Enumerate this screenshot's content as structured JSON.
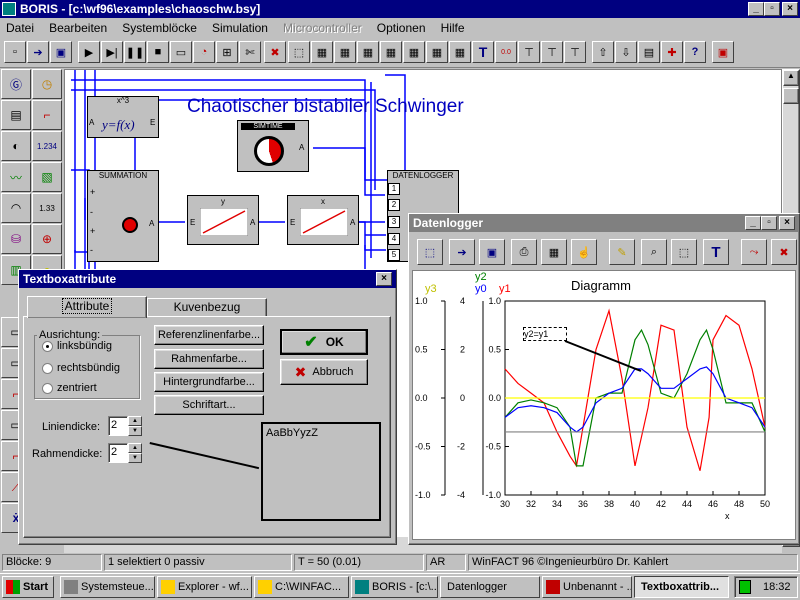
{
  "app": {
    "title": "BORIS - [c:\\wf96\\examples\\chaoschw.bsy]",
    "menus": [
      "Datei",
      "Bearbeiten",
      "Systemblöcke",
      "Simulation",
      "Microcontroller",
      "Optionen",
      "Hilfe"
    ],
    "menus_disabled": [
      "Microcontroller"
    ]
  },
  "diagram": {
    "heading": "Chaotischer bistabiler Schwinger",
    "blocks": {
      "power": {
        "title": "x^3",
        "formula": "y=f(x)",
        "in": "A",
        "out": "E"
      },
      "simtime": {
        "title": "SIMTIME",
        "out": "A"
      },
      "summation": {
        "title": "SUMMATION",
        "out": "A",
        "signs": [
          "+",
          "-",
          "+",
          "-",
          "+"
        ]
      },
      "integrator_y": {
        "title": "y",
        "in": "E",
        "out": "A"
      },
      "integrator_x": {
        "title": "x",
        "in": "E",
        "out": "A"
      },
      "datalogger": {
        "title": "DATENLOGGER",
        "ports": [
          "1",
          "2",
          "3",
          "4",
          "5"
        ]
      }
    }
  },
  "datalogger_window": {
    "title": "Datenlogger",
    "legend": {
      "y3": "y3",
      "y0": "y0",
      "y2": "y2",
      "y1": "y1"
    },
    "colors": {
      "y0": "#0000ff",
      "y1": "#ff0000",
      "y2": "#008000",
      "y3": "#ffff00"
    },
    "annotation": "y2=y1",
    "chart_data": {
      "type": "line",
      "title": "Diagramm",
      "xlabel": "x",
      "ylabel": "",
      "xlim": [
        30,
        50
      ],
      "xticks": [
        "30",
        "32",
        "34",
        "36",
        "38",
        "40",
        "42",
        "44",
        "46",
        "48",
        "50"
      ],
      "y_left_ticks": [
        "1.0",
        "0.5",
        "0.0",
        "-0.5",
        "-1.0"
      ],
      "y_right_ticks": [
        "4",
        "2",
        "0",
        "-2",
        "-4"
      ],
      "y_mid_ticks": [
        "1.0",
        "0.5",
        "0.0",
        "-0.5",
        "-1.0"
      ],
      "ylim": [
        -1,
        1
      ],
      "y2lim": [
        -4,
        4
      ],
      "series": [
        {
          "name": "y1",
          "color": "#ff0000",
          "x": [
            30,
            31,
            32,
            33,
            34,
            35,
            35.5,
            36,
            37,
            38,
            39,
            40,
            41,
            42,
            43,
            44,
            45,
            45.7,
            46,
            47,
            48,
            49,
            50
          ],
          "values": [
            0.3,
            0.15,
            0.05,
            -0.05,
            -0.35,
            -0.6,
            -0.7,
            -0.3,
            0.5,
            0.9,
            0.2,
            -0.7,
            -0.1,
            0.75,
            0.7,
            -0.3,
            -0.75,
            -0.2,
            0.6,
            0.85,
            0.75,
            0.3,
            -0.3
          ]
        },
        {
          "name": "y2",
          "color": "#008000",
          "x": [
            30,
            31,
            32,
            33,
            34,
            35,
            35.5,
            36,
            37,
            38,
            39,
            40,
            40.5,
            41,
            42,
            43,
            44,
            45,
            45.5,
            46,
            47,
            48,
            49,
            50
          ],
          "values": [
            -0.2,
            -0.05,
            -0.02,
            -0.05,
            -0.1,
            -0.3,
            -0.7,
            -0.7,
            0.0,
            0.05,
            0.05,
            0.6,
            0.7,
            0.55,
            0.05,
            0.0,
            0.25,
            0.6,
            0.7,
            0.5,
            -0.05,
            -0.05,
            -0.05,
            -0.35
          ]
        },
        {
          "name": "y0",
          "color": "#0000ff",
          "x": [
            30,
            31,
            32,
            33,
            34,
            35,
            35.5,
            36,
            37,
            38,
            39,
            40,
            40.5,
            41,
            42,
            43,
            44,
            45,
            45.5,
            46,
            47,
            48,
            49,
            50
          ],
          "values": [
            -0.2,
            -0.1,
            -0.08,
            -0.1,
            -0.15,
            -0.3,
            -0.35,
            -0.3,
            -0.05,
            0.05,
            0.1,
            0.3,
            0.3,
            0.25,
            0.1,
            0.1,
            0.2,
            0.3,
            0.32,
            0.25,
            0.0,
            -0.05,
            -0.1,
            -0.3
          ]
        },
        {
          "name": "y3",
          "color": "#ffff00",
          "x": [
            30,
            50
          ],
          "values": [
            0.0,
            0.0
          ]
        },
        {
          "name": "reference",
          "color": "#808080",
          "x": [
            30,
            50
          ],
          "values": [
            -0.35,
            -0.35
          ]
        }
      ]
    }
  },
  "dialog": {
    "title": "Textboxattribute",
    "tabs": [
      "Attribute",
      "Kuvenbezug"
    ],
    "group_label": "Ausrichtung:",
    "radios": [
      "linksbündig",
      "rechtsbündig",
      "zentriert"
    ],
    "selected_radio": "linksbündig",
    "buttons": [
      "Referenzlinenfarbe...",
      "Rahmenfarbe...",
      "Hintergrundfarbe...",
      "Schriftart..."
    ],
    "ok": "OK",
    "cancel": "Abbruch",
    "line_width_label": "Liniendicke:",
    "line_width": "2",
    "frame_width_label": "Rahmendicke:",
    "frame_width": "2",
    "preview": "AaBbYyzZ"
  },
  "status": {
    "blocks": "Blöcke: 9",
    "selection": "1 selektiert  0 passiv",
    "time": "T = 50  (0.01)",
    "ar": "AR",
    "copyright": "WinFACT 96  ©Ingenieurbüro Dr. Kahlert"
  },
  "taskbar": {
    "start": "Start",
    "items": [
      "Systemsteue...",
      "Explorer - wf...",
      "C:\\WINFAC...",
      "BORIS - [c:\\...",
      "Datenlogger",
      "Unbenannt - ...",
      "Textboxattrib..."
    ],
    "active": "Textboxattrib...",
    "clock": "18:32"
  }
}
